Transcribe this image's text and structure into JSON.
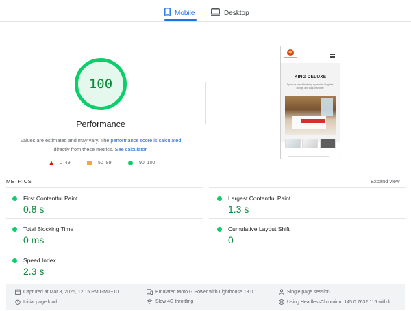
{
  "tabs": {
    "mobile": "Mobile",
    "desktop": "Desktop",
    "active": "mobile"
  },
  "performance": {
    "score": "100",
    "score_value": 100,
    "title": "Performance",
    "desc_prefix": "Values are estimated and may vary. The ",
    "desc_link1": "performance score is calculated",
    "desc_middle": " directly from these metrics. ",
    "desc_link2": "See calculator",
    "desc_suffix": ".",
    "gauge_color": "#0cce6b"
  },
  "legend": {
    "fail": "0–49",
    "average": "50–89",
    "pass": "90–100",
    "colors": {
      "fail": "#eb0f00",
      "average": "#f4a734",
      "pass": "#0cce6b"
    }
  },
  "preview": {
    "title": "KING DELUXE",
    "subtitle": "Spacious layout featuring a premium King bed, lounge, and walk-in shower."
  },
  "metrics": {
    "heading": "METRICS",
    "expand": "Expand view",
    "items": [
      {
        "name": "First Contentful Paint",
        "value": "0.8 s"
      },
      {
        "name": "Largest Contentful Paint",
        "value": "1.3 s"
      },
      {
        "name": "Total Blocking Time",
        "value": "0 ms"
      },
      {
        "name": "Cumulative Layout Shift",
        "value": "0"
      },
      {
        "name": "Speed Index",
        "value": "2.3 s"
      }
    ]
  },
  "footer": {
    "captured": "Captured at Mar 8, 2026, 12:15 PM GMT+10",
    "emulated": "Emulated Moto G Power with Lighthouse 13.0.1",
    "session": "Single page session",
    "page_load": "Initial page load",
    "throttling": "Slow 4G throttling",
    "browser": "Using HeadlessChromium 145.0.7632.116 with lr"
  }
}
